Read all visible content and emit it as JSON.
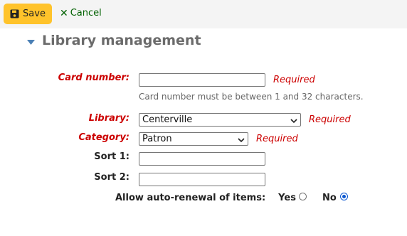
{
  "toolbar": {
    "save_label": "Save",
    "save_icon": "save-icon",
    "cancel_label": "Cancel",
    "cancel_icon": "close-icon"
  },
  "section": {
    "title": "Library management",
    "toggle_icon": "caret-down-icon"
  },
  "form": {
    "card_number": {
      "label": "Card number:",
      "value": "",
      "required_text": "Required",
      "hint": "Card number must be between 1 and 32 characters."
    },
    "library": {
      "label": "Library:",
      "selected": "Centerville",
      "required_text": "Required"
    },
    "category": {
      "label": "Category:",
      "selected": "Patron",
      "required_text": "Required"
    },
    "sort1": {
      "label": "Sort 1:",
      "value": ""
    },
    "sort2": {
      "label": "Sort 2:",
      "value": ""
    },
    "auto_renewal": {
      "label": "Allow auto-renewal of items:",
      "options": [
        {
          "label": "Yes",
          "checked": false
        },
        {
          "label": "No",
          "checked": true
        }
      ]
    }
  },
  "colors": {
    "save_button_bg": "#ffc32b",
    "cancel_link": "#006100",
    "required": "#cc0000",
    "section_title": "#6b6b6b",
    "toggle_caret": "#4a7fb5",
    "toolbar_bg": "#f4f4f4"
  }
}
